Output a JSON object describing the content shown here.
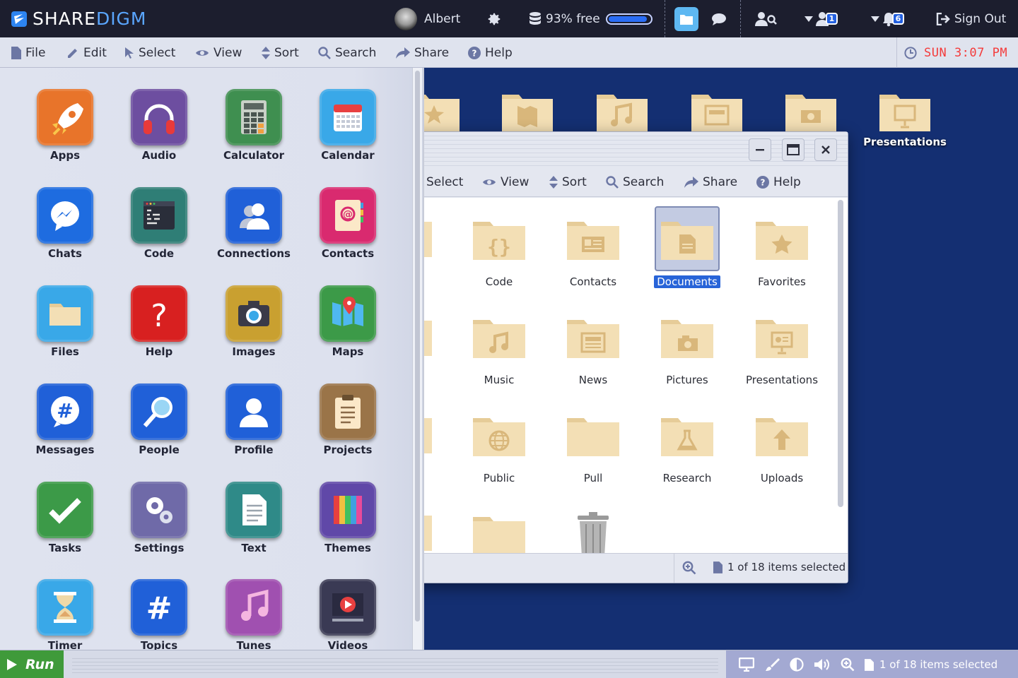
{
  "topbar": {
    "brand_a": "SHARE",
    "brand_b": "DIGM",
    "user_name": "Albert",
    "disk_label": "93% free",
    "disk_percent": 93,
    "contacts_badge": "1",
    "notifications_badge": "6",
    "signout_label": "Sign Out"
  },
  "menubar": {
    "file": "File",
    "edit": "Edit",
    "select": "Select",
    "view": "View",
    "sort": "Sort",
    "search": "Search",
    "share": "Share",
    "help": "Help",
    "clock": "SUN 3:07 PM"
  },
  "desktop": {
    "visible_label": "Presentations"
  },
  "file_window": {
    "menu": {
      "select": "Select",
      "view": "View",
      "sort": "Sort",
      "search": "Search",
      "share": "Share",
      "help": "Help"
    },
    "items": [
      {
        "label": "Code",
        "icon": "braces-folder-icon"
      },
      {
        "label": "Contacts",
        "icon": "contact-card-folder-icon"
      },
      {
        "label": "Documents",
        "icon": "document-folder-icon",
        "selected": true
      },
      {
        "label": "Favorites",
        "icon": "star-folder-icon"
      },
      {
        "label": "Music",
        "icon": "music-folder-icon"
      },
      {
        "label": "News",
        "icon": "newspaper-folder-icon"
      },
      {
        "label": "Pictures",
        "icon": "camera-folder-icon"
      },
      {
        "label": "Presentations",
        "icon": "presentation-folder-icon"
      },
      {
        "label": "Public",
        "icon": "globe-folder-icon"
      },
      {
        "label": "Pull",
        "icon": "folder-icon"
      },
      {
        "label": "Research",
        "icon": "flask-folder-icon"
      },
      {
        "label": "Uploads",
        "icon": "upload-folder-icon"
      }
    ],
    "status": "1 of 18 items selected"
  },
  "apps": [
    {
      "label": "Apps",
      "icon": "rocket-icon",
      "color": "#e8742a"
    },
    {
      "label": "Audio",
      "icon": "headphones-icon",
      "color": "#6d4ea0"
    },
    {
      "label": "Calculator",
      "icon": "calculator-icon",
      "color": "#3f8f50"
    },
    {
      "label": "Calendar",
      "icon": "calendar-icon",
      "color": "#39a8e8"
    },
    {
      "label": "Chats",
      "icon": "messenger-icon",
      "color": "#1e6ce0"
    },
    {
      "label": "Code",
      "icon": "terminal-icon",
      "color": "#2f7e76"
    },
    {
      "label": "Connections",
      "icon": "users-icon",
      "color": "#2060d8"
    },
    {
      "label": "Contacts",
      "icon": "address-book-icon",
      "color": "#d92a6f"
    },
    {
      "label": "Files",
      "icon": "folder-icon",
      "color": "#39a8e8"
    },
    {
      "label": "Help",
      "icon": "question-icon",
      "color": "#d82020"
    },
    {
      "label": "Images",
      "icon": "camera-icon",
      "color": "#c9a030"
    },
    {
      "label": "Maps",
      "icon": "map-icon",
      "color": "#3c9a48"
    },
    {
      "label": "Messages",
      "icon": "hashtag-bubble-icon",
      "color": "#2060d8"
    },
    {
      "label": "People",
      "icon": "magnifier-icon",
      "color": "#2060d8"
    },
    {
      "label": "Profile",
      "icon": "person-icon",
      "color": "#2060d8"
    },
    {
      "label": "Projects",
      "icon": "clipboard-icon",
      "color": "#9a7448"
    },
    {
      "label": "Tasks",
      "icon": "checkmark-icon",
      "color": "#3c9a48"
    },
    {
      "label": "Settings",
      "icon": "gears-icon",
      "color": "#6f6aa8"
    },
    {
      "label": "Text",
      "icon": "text-document-icon",
      "color": "#2f8a88"
    },
    {
      "label": "Themes",
      "icon": "palette-icon",
      "color": "#6048a8"
    },
    {
      "label": "Timer",
      "icon": "hourglass-icon",
      "color": "#39a8e8"
    },
    {
      "label": "Topics",
      "icon": "hashtag-icon",
      "color": "#2060d8"
    },
    {
      "label": "Tunes",
      "icon": "music-note-icon",
      "color": "#a050b0"
    },
    {
      "label": "Videos",
      "icon": "video-play-icon",
      "color": "#3a3a54"
    }
  ],
  "taskbar": {
    "run_label": "Run",
    "status": "1 of 18 items selected"
  },
  "colors": {
    "desktop": "#142f72",
    "folder": "#f3dfb5",
    "selection": "#2864d8",
    "clock": "#f43b3b"
  }
}
